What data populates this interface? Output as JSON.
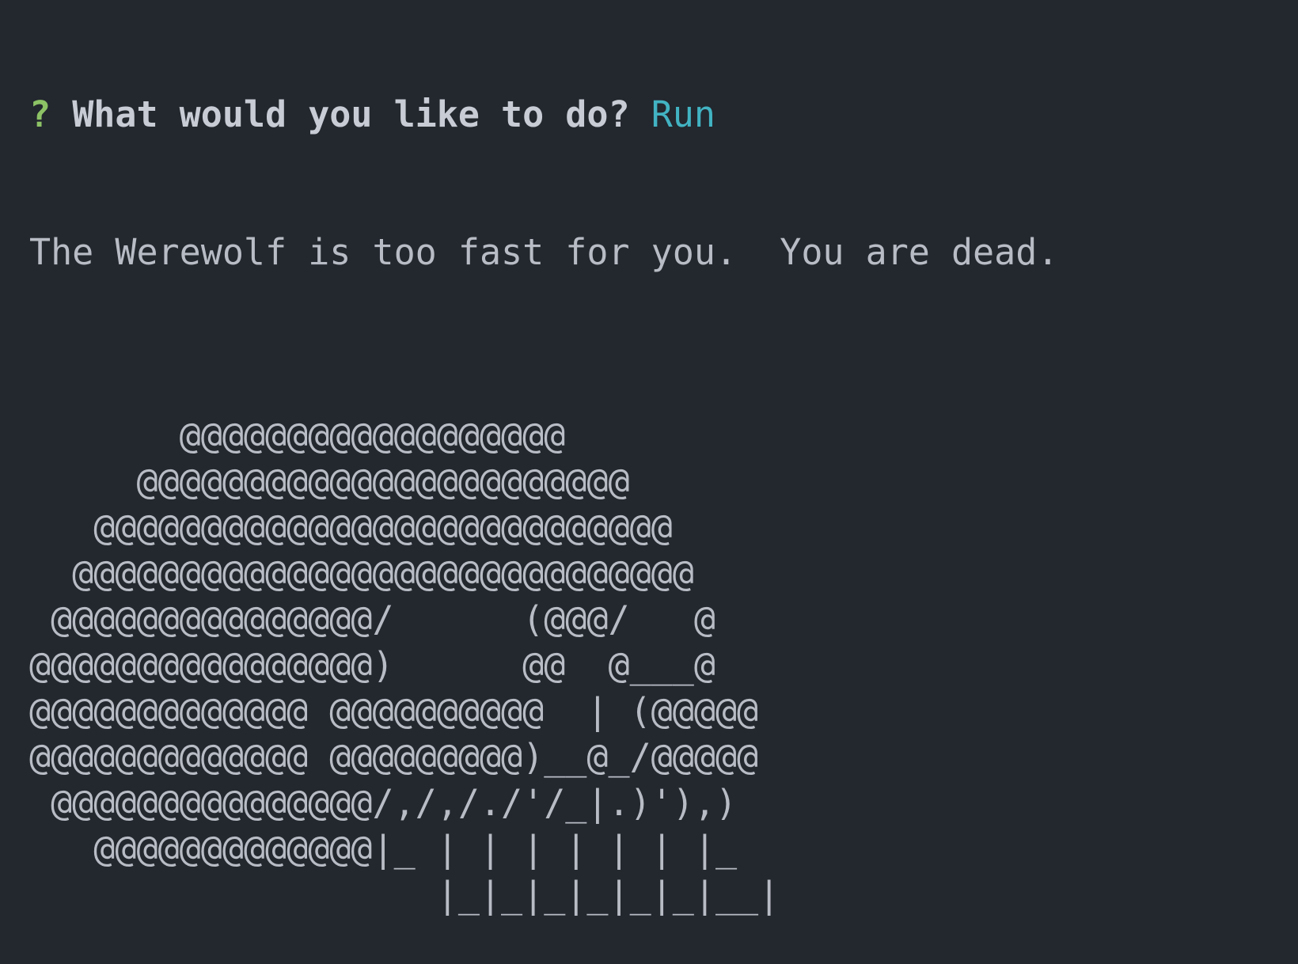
{
  "prompt": {
    "marker": "?",
    "question": "What would you like to do?",
    "answer": "Run"
  },
  "message": "The Werewolf is too fast for you.  You are dead.",
  "ascii_art": [
    "       @@@@@@@@@@@@@@@@@@",
    "     @@@@@@@@@@@@@@@@@@@@@@@",
    "   @@@@@@@@@@@@@@@@@@@@@@@@@@@",
    "  @@@@@@@@@@@@@@@@@@@@@@@@@@@@@",
    " @@@@@@@@@@@@@@@/      (@@@/   @",
    "@@@@@@@@@@@@@@@@)      @@  @___@",
    "@@@@@@@@@@@@@ @@@@@@@@@@  | (@@@@@",
    "@@@@@@@@@@@@@ @@@@@@@@@)__@_/@@@@@",
    " @@@@@@@@@@@@@@@/,/,/./'/_|.)'),)",
    "   @@@@@@@@@@@@@|_ | | | | | | |_",
    "                   |_|_|_|_|_|_|__|"
  ],
  "colors": {
    "background": "#23272e",
    "prompt_marker": "#8cc265",
    "question": "#c8ccd4",
    "answer": "#42b3c2",
    "text": "#b8bcc4"
  }
}
